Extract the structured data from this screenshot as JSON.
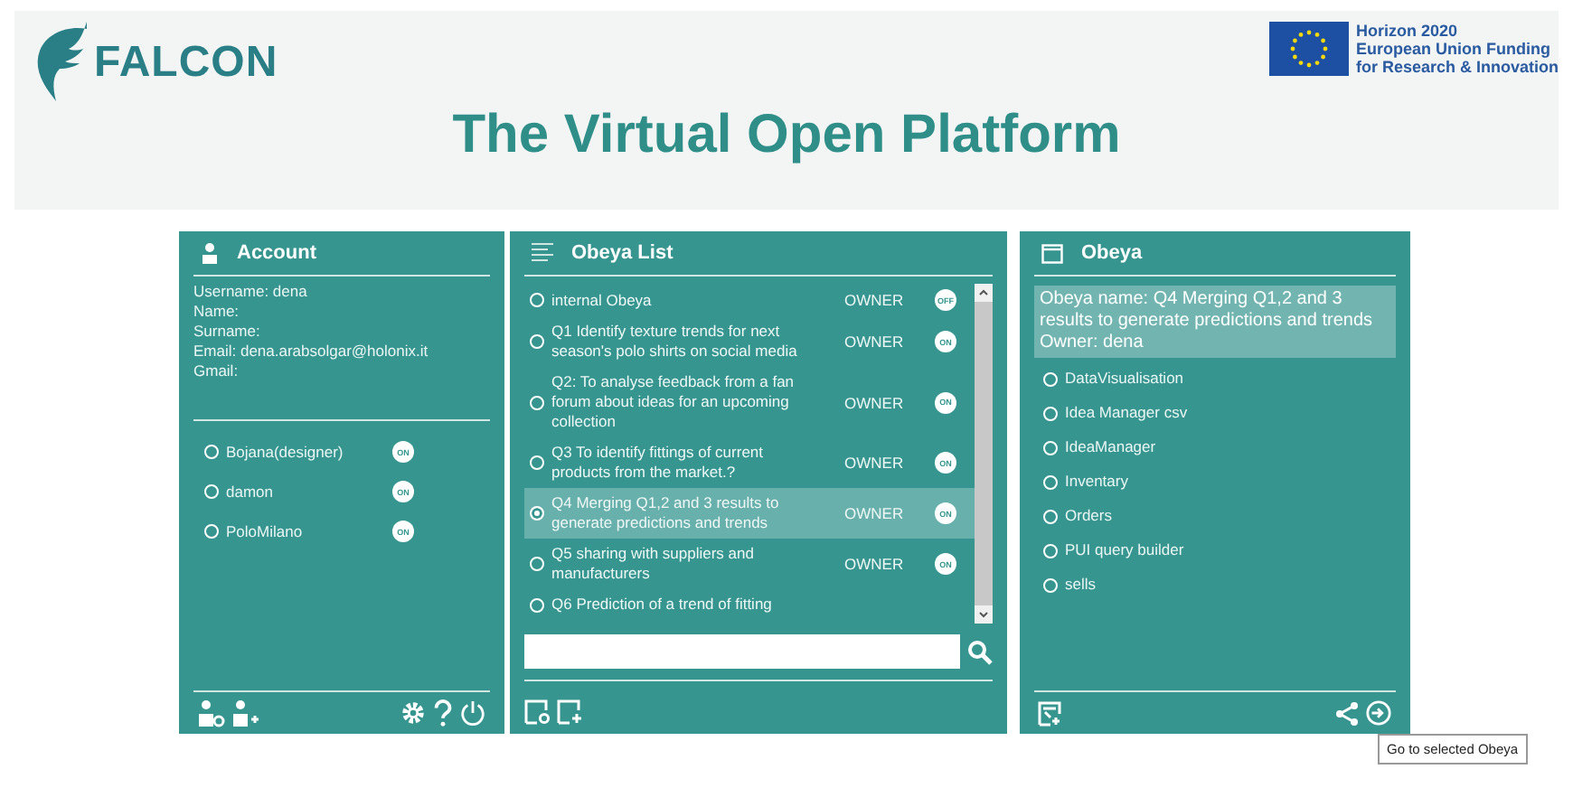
{
  "brand": {
    "name": "FALCON"
  },
  "funding": {
    "lines": [
      "Horizon 2020",
      "European Union Funding",
      "for Research & Innovation"
    ]
  },
  "title": "The Virtual Open Platform",
  "account": {
    "title": "Account",
    "fields": [
      "Username: dena",
      "Name:",
      "Surname:",
      "Email: dena.arabsolgar@holonix.it",
      "Gmail:"
    ],
    "contacts": [
      {
        "name": "Bojana(designer)",
        "toggle": "ON",
        "selected": false
      },
      {
        "name": "damon",
        "toggle": "ON",
        "selected": false
      },
      {
        "name": "PoloMilano",
        "toggle": "ON",
        "selected": false
      }
    ]
  },
  "obeya_list": {
    "title": "Obeya List",
    "items": [
      {
        "name": "internal Obeya",
        "role": "OWNER",
        "toggle": "OFF",
        "selected": false
      },
      {
        "name": "Q1 Identify texture trends for next season's polo shirts on social media",
        "role": "OWNER",
        "toggle": "ON",
        "selected": false
      },
      {
        "name": "Q2: To analyse feedback from a fan forum about ideas for an upcoming collection",
        "role": "OWNER",
        "toggle": "ON",
        "selected": false
      },
      {
        "name": "Q3 To identify fittings of current products from the market.?",
        "role": "OWNER",
        "toggle": "ON",
        "selected": false
      },
      {
        "name": "Q4 Merging Q1,2 and 3 results to generate predictions and trends",
        "role": "OWNER",
        "toggle": "ON",
        "selected": true
      },
      {
        "name": "Q5 sharing with suppliers and manufacturers",
        "role": "OWNER",
        "toggle": "ON",
        "selected": false
      },
      {
        "name": "Q6  Prediction of a trend of fitting",
        "selected": false
      }
    ]
  },
  "obeya": {
    "title": "Obeya",
    "details": [
      "Obeya name: Q4 Merging Q1,2 and 3 results to generate predictions and trends",
      "Owner: dena"
    ],
    "tools": [
      {
        "name": "DataVisualisation",
        "selected": false
      },
      {
        "name": "Idea Manager csv",
        "selected": false
      },
      {
        "name": "IdeaManager",
        "selected": false
      },
      {
        "name": "Inventary",
        "selected": false
      },
      {
        "name": "Orders",
        "selected": false
      },
      {
        "name": "PUI query builder",
        "selected": false
      },
      {
        "name": "sells",
        "selected": false
      }
    ]
  },
  "tooltip": "Go to selected Obeya"
}
